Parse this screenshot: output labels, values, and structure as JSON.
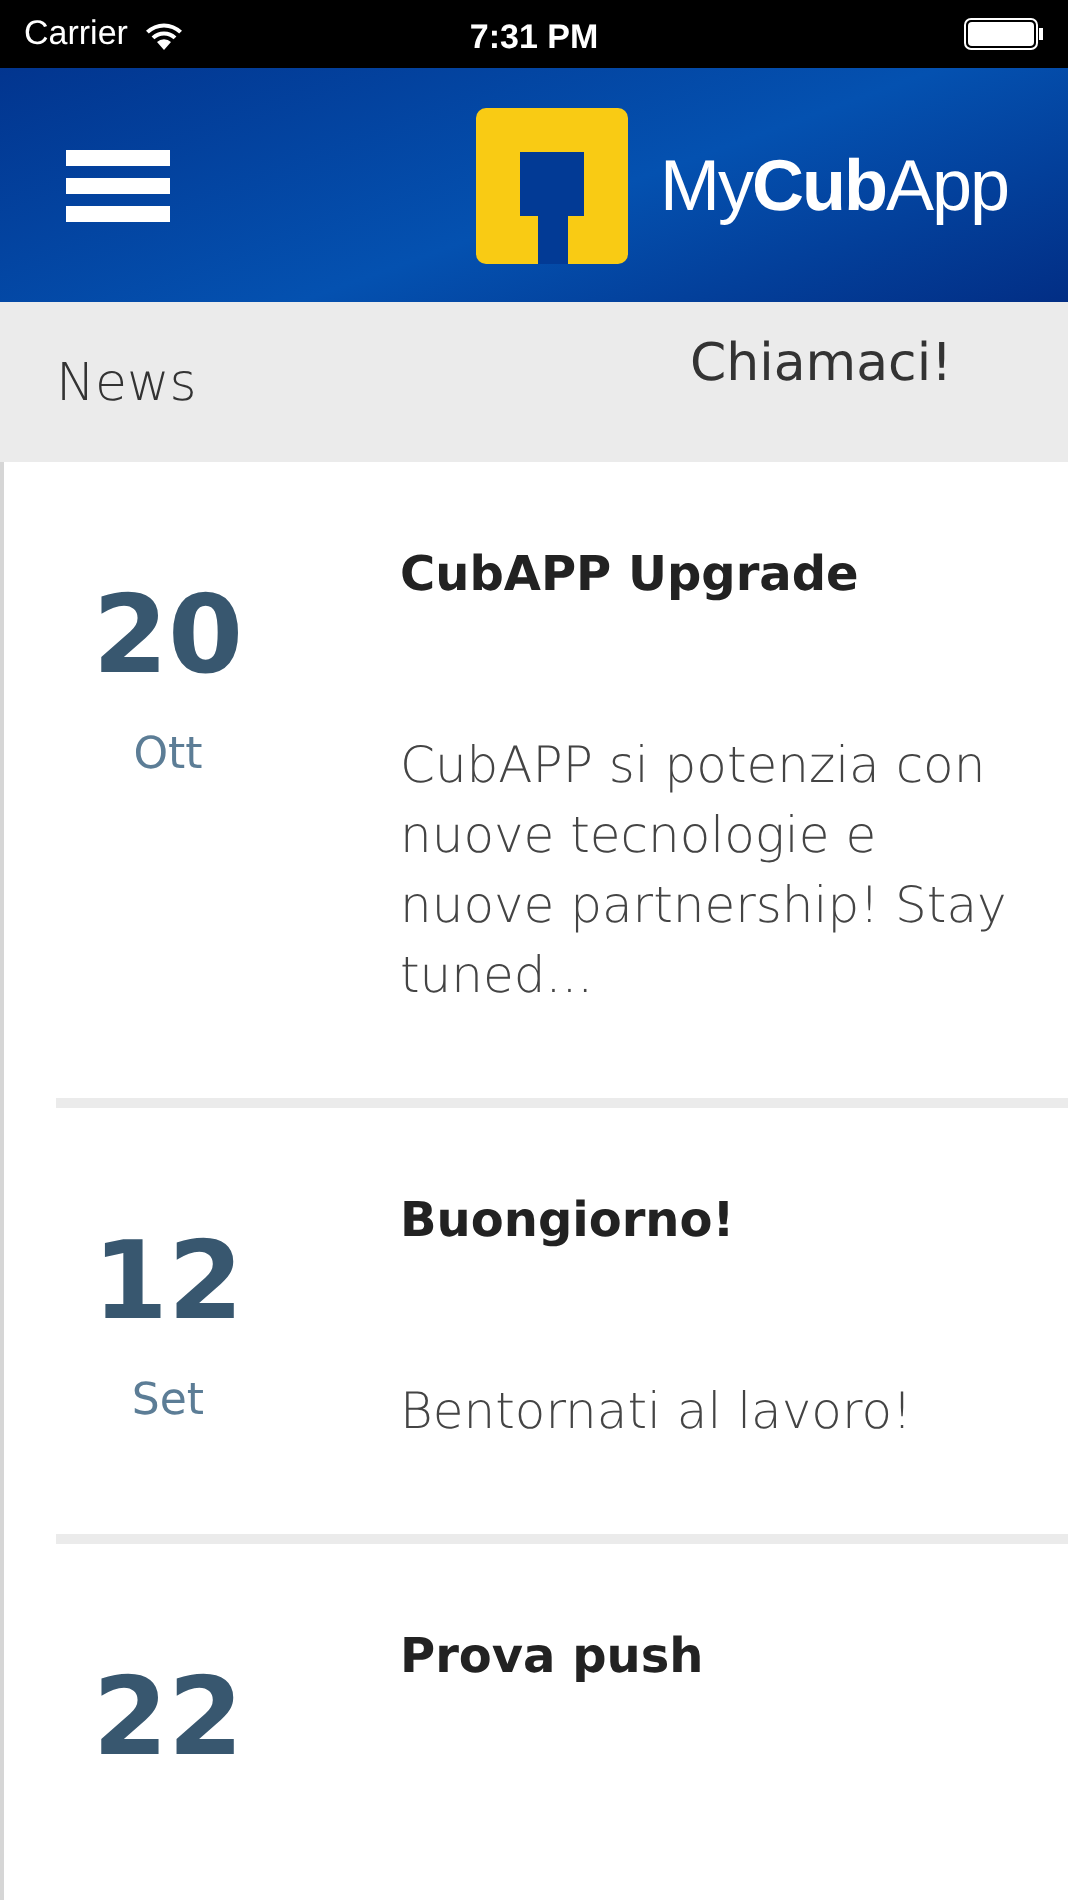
{
  "status_bar": {
    "carrier": "Carrier",
    "time": "7:31 PM"
  },
  "header": {
    "logo_text": "My**Cub**App"
  },
  "subbar": {
    "title": "News",
    "call_link": "Chiamaci!"
  },
  "news": [
    {
      "day": "20",
      "month": "Ott",
      "title": "CubAPP Upgrade",
      "body": "CubAPP si potenzia con nuove tecnologie e nuove partnership! Stay tuned..."
    },
    {
      "day": "12",
      "month": "Set",
      "title": "Buongiorno!",
      "body": "Bentornati al lavoro!"
    },
    {
      "day": "22",
      "title": "Prova push"
    }
  ]
}
